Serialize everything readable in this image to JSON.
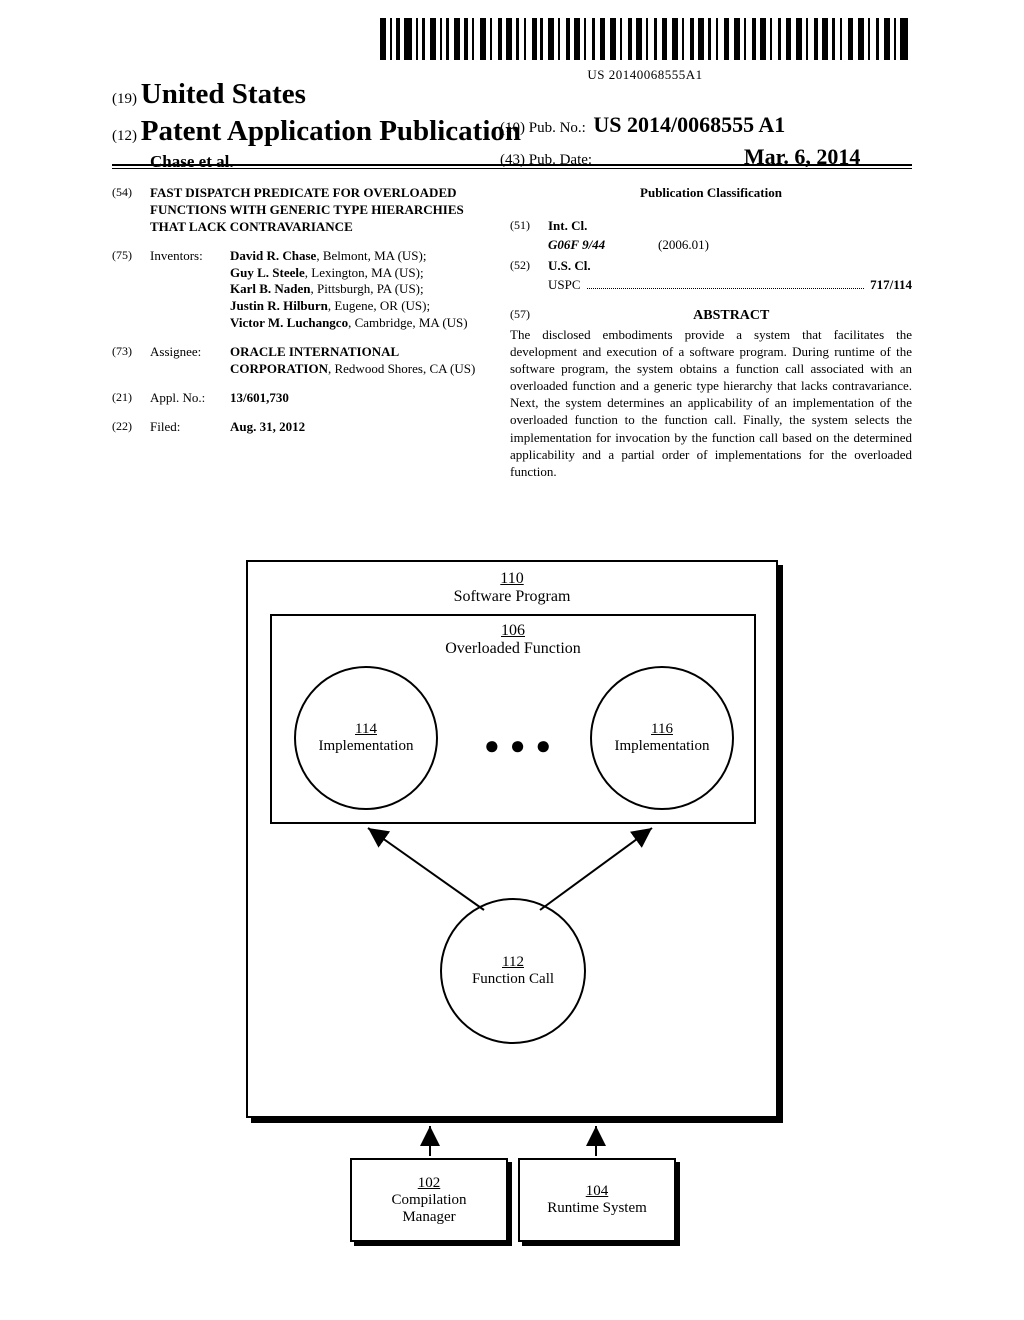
{
  "barcode_text": "US 20140068555A1",
  "header": {
    "country_code": "(19)",
    "country": "United States",
    "kind_code": "(12)",
    "kind": "Patent Application Publication",
    "authors": "Chase et al.",
    "pubno_code": "(10)",
    "pubno_label": "Pub. No.:",
    "pubno_value": "US 2014/0068555 A1",
    "pubdate_code": "(43)",
    "pubdate_label": "Pub. Date:",
    "pubdate_value": "Mar. 6, 2014"
  },
  "left": {
    "title_code": "(54)",
    "title": "FAST DISPATCH PREDICATE FOR OVERLOADED FUNCTIONS WITH GENERIC TYPE HIERARCHIES THAT LACK CONTRAVARIANCE",
    "inventors_code": "(75)",
    "inventors_label": "Inventors:",
    "inventors": [
      {
        "name": "David R. Chase",
        "loc": ", Belmont, MA (US);"
      },
      {
        "name": "Guy L. Steele",
        "loc": ", Lexington, MA (US);"
      },
      {
        "name": "Karl B. Naden",
        "loc": ", Pittsburgh, PA (US);"
      },
      {
        "name": "Justin R. Hilburn",
        "loc": ", Eugene, OR (US);"
      },
      {
        "name": "Victor M. Luchangco",
        "loc": ", Cambridge, MA (US)"
      }
    ],
    "assignee_code": "(73)",
    "assignee_label": "Assignee:",
    "assignee_name": "ORACLE INTERNATIONAL CORPORATION",
    "assignee_loc": ", Redwood Shores, CA (US)",
    "applno_code": "(21)",
    "applno_label": "Appl. No.:",
    "applno_value": "13/601,730",
    "filed_code": "(22)",
    "filed_label": "Filed:",
    "filed_value": "Aug. 31, 2012"
  },
  "right": {
    "pubclass_heading": "Publication Classification",
    "intcl_code": "(51)",
    "intcl_label": "Int. Cl.",
    "intcl_name": "G06F 9/44",
    "intcl_year": "(2006.01)",
    "uscl_code": "(52)",
    "uscl_label": "U.S. Cl.",
    "uscl_name": "USPC",
    "uscl_value": "717/114",
    "abstract_code": "(57)",
    "abstract_heading": "ABSTRACT",
    "abstract_text": "The disclosed embodiments provide a system that facilitates the development and execution of a software program. During runtime of the software program, the system obtains a function call associated with an overloaded function and a generic type hierarchy that lacks contravariance. Next, the system determines an applicability of an implementation of the overloaded function to the function call. Finally, the system selects the implementation for invocation by the function call based on the determined applicability and a partial order of implementations for the overloaded function."
  },
  "diagram": {
    "n110": "110",
    "l110": "Software Program",
    "n106": "106",
    "l106": "Overloaded Function",
    "n114": "114",
    "l114": "Implementation",
    "n116": "116",
    "l116": "Implementation",
    "n112": "112",
    "l112": "Function Call",
    "n102": "102",
    "l102a": "Compilation",
    "l102b": "Manager",
    "n104": "104",
    "l104": "Runtime System"
  }
}
